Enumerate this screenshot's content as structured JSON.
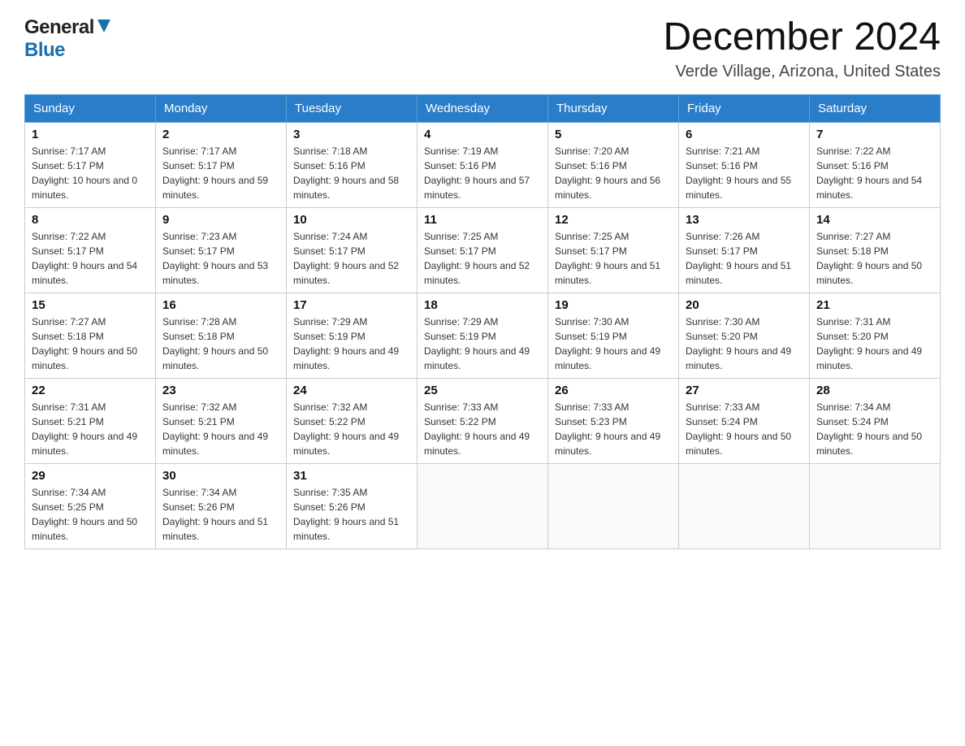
{
  "header": {
    "logo_general": "General",
    "logo_blue": "Blue",
    "title": "December 2024",
    "subtitle": "Verde Village, Arizona, United States"
  },
  "calendar": {
    "days_of_week": [
      "Sunday",
      "Monday",
      "Tuesday",
      "Wednesday",
      "Thursday",
      "Friday",
      "Saturday"
    ],
    "weeks": [
      [
        {
          "day": "1",
          "sunrise": "7:17 AM",
          "sunset": "5:17 PM",
          "daylight": "10 hours and 0 minutes."
        },
        {
          "day": "2",
          "sunrise": "7:17 AM",
          "sunset": "5:17 PM",
          "daylight": "9 hours and 59 minutes."
        },
        {
          "day": "3",
          "sunrise": "7:18 AM",
          "sunset": "5:16 PM",
          "daylight": "9 hours and 58 minutes."
        },
        {
          "day": "4",
          "sunrise": "7:19 AM",
          "sunset": "5:16 PM",
          "daylight": "9 hours and 57 minutes."
        },
        {
          "day": "5",
          "sunrise": "7:20 AM",
          "sunset": "5:16 PM",
          "daylight": "9 hours and 56 minutes."
        },
        {
          "day": "6",
          "sunrise": "7:21 AM",
          "sunset": "5:16 PM",
          "daylight": "9 hours and 55 minutes."
        },
        {
          "day": "7",
          "sunrise": "7:22 AM",
          "sunset": "5:16 PM",
          "daylight": "9 hours and 54 minutes."
        }
      ],
      [
        {
          "day": "8",
          "sunrise": "7:22 AM",
          "sunset": "5:17 PM",
          "daylight": "9 hours and 54 minutes."
        },
        {
          "day": "9",
          "sunrise": "7:23 AM",
          "sunset": "5:17 PM",
          "daylight": "9 hours and 53 minutes."
        },
        {
          "day": "10",
          "sunrise": "7:24 AM",
          "sunset": "5:17 PM",
          "daylight": "9 hours and 52 minutes."
        },
        {
          "day": "11",
          "sunrise": "7:25 AM",
          "sunset": "5:17 PM",
          "daylight": "9 hours and 52 minutes."
        },
        {
          "day": "12",
          "sunrise": "7:25 AM",
          "sunset": "5:17 PM",
          "daylight": "9 hours and 51 minutes."
        },
        {
          "day": "13",
          "sunrise": "7:26 AM",
          "sunset": "5:17 PM",
          "daylight": "9 hours and 51 minutes."
        },
        {
          "day": "14",
          "sunrise": "7:27 AM",
          "sunset": "5:18 PM",
          "daylight": "9 hours and 50 minutes."
        }
      ],
      [
        {
          "day": "15",
          "sunrise": "7:27 AM",
          "sunset": "5:18 PM",
          "daylight": "9 hours and 50 minutes."
        },
        {
          "day": "16",
          "sunrise": "7:28 AM",
          "sunset": "5:18 PM",
          "daylight": "9 hours and 50 minutes."
        },
        {
          "day": "17",
          "sunrise": "7:29 AM",
          "sunset": "5:19 PM",
          "daylight": "9 hours and 49 minutes."
        },
        {
          "day": "18",
          "sunrise": "7:29 AM",
          "sunset": "5:19 PM",
          "daylight": "9 hours and 49 minutes."
        },
        {
          "day": "19",
          "sunrise": "7:30 AM",
          "sunset": "5:19 PM",
          "daylight": "9 hours and 49 minutes."
        },
        {
          "day": "20",
          "sunrise": "7:30 AM",
          "sunset": "5:20 PM",
          "daylight": "9 hours and 49 minutes."
        },
        {
          "day": "21",
          "sunrise": "7:31 AM",
          "sunset": "5:20 PM",
          "daylight": "9 hours and 49 minutes."
        }
      ],
      [
        {
          "day": "22",
          "sunrise": "7:31 AM",
          "sunset": "5:21 PM",
          "daylight": "9 hours and 49 minutes."
        },
        {
          "day": "23",
          "sunrise": "7:32 AM",
          "sunset": "5:21 PM",
          "daylight": "9 hours and 49 minutes."
        },
        {
          "day": "24",
          "sunrise": "7:32 AM",
          "sunset": "5:22 PM",
          "daylight": "9 hours and 49 minutes."
        },
        {
          "day": "25",
          "sunrise": "7:33 AM",
          "sunset": "5:22 PM",
          "daylight": "9 hours and 49 minutes."
        },
        {
          "day": "26",
          "sunrise": "7:33 AM",
          "sunset": "5:23 PM",
          "daylight": "9 hours and 49 minutes."
        },
        {
          "day": "27",
          "sunrise": "7:33 AM",
          "sunset": "5:24 PM",
          "daylight": "9 hours and 50 minutes."
        },
        {
          "day": "28",
          "sunrise": "7:34 AM",
          "sunset": "5:24 PM",
          "daylight": "9 hours and 50 minutes."
        }
      ],
      [
        {
          "day": "29",
          "sunrise": "7:34 AM",
          "sunset": "5:25 PM",
          "daylight": "9 hours and 50 minutes."
        },
        {
          "day": "30",
          "sunrise": "7:34 AM",
          "sunset": "5:26 PM",
          "daylight": "9 hours and 51 minutes."
        },
        {
          "day": "31",
          "sunrise": "7:35 AM",
          "sunset": "5:26 PM",
          "daylight": "9 hours and 51 minutes."
        },
        null,
        null,
        null,
        null
      ]
    ]
  }
}
